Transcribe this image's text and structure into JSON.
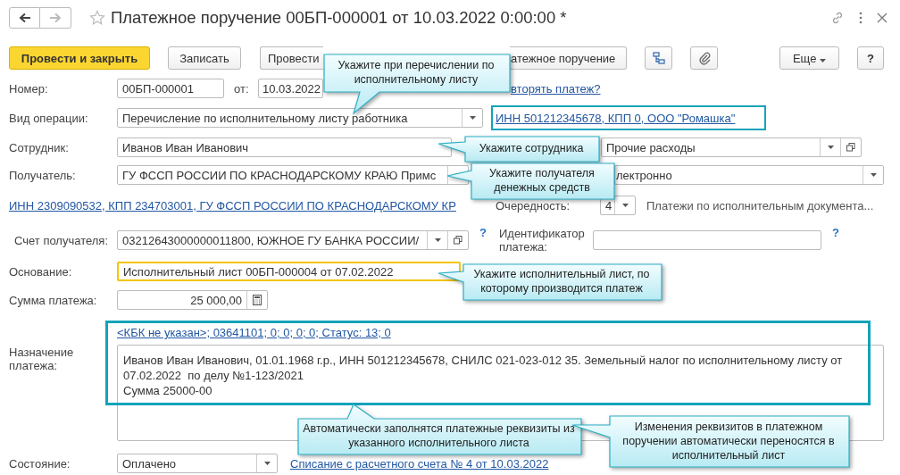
{
  "window": {
    "title": "Платежное поручение 00БП-000001 от 10.03.2022 0:00:00 *"
  },
  "toolbar": {
    "buttons": [
      {
        "kind": "primary",
        "label": "Провести и закрыть"
      },
      {
        "kind": "text",
        "label": "Записать"
      },
      {
        "kind": "text",
        "label": "Провести"
      },
      {
        "kind": "text",
        "label": "атежное поручение"
      }
    ],
    "more_button": "Еще",
    "help_button": "?"
  },
  "form": {
    "number": {
      "label": "Номер:",
      "value": "00БП-000001"
    },
    "date": {
      "label": "от:",
      "value": "10.03.2022"
    },
    "repeat_link": "вторять платеж?",
    "operation": {
      "label": "Вид операции:",
      "value": "Перечисление по исполнительному листу работника"
    },
    "payer_link": "ИНН 501212345678, КПП 0, ООО \"Ромашка\"",
    "employee": {
      "label": "Сотрудник:",
      "value": "Иванов Иван Иванович"
    },
    "expense": {
      "value": "Прочие расходы"
    },
    "recipient": {
      "label": "Получатель:",
      "value": "ГУ ФССП РОССИИ ПО КРАСНОДАРСКОМУ КРАЮ Примс"
    },
    "payment_method": {
      "value": "лектронно"
    },
    "recipient_link": "ИНН 2309090532, КПП 234703001, ГУ ФССП РОССИИ ПО КРАСНОДАРСКОМУ КР",
    "priority": {
      "label": "Очередность:",
      "value": "4",
      "description": "Платежи по исполнительным документа..."
    },
    "account": {
      "label": "Счет получателя:",
      "value": "03212643000000011800, ЮЖНОЕ ГУ БАНКА РОССИИ/",
      "help": "?"
    },
    "payment_id": {
      "label": "Идентификатор платежа:",
      "help": "?"
    },
    "basis": {
      "label": "Основание:",
      "value": "Исполнительный лист 00БП-000004 от 07.02.2022",
      "focused": true
    },
    "amount": {
      "label": "Сумма платежа:",
      "value": "25 000,00"
    },
    "purpose": {
      "label": "Назначение платежа:",
      "codes_link": "<КБК не указан>; 03641101; 0; 0; 0; 0; Статус: 13; 0",
      "text": "Иванов Иван Иванович, 01.01.1968 г.р., ИНН 501212345678, СНИЛС 021-023-012 35. Земельный налог по исполнительному листу от 07.02.2022  по делу №1-123/2021\nСумма 25000-00"
    },
    "status": {
      "label": "Состояние:",
      "value": "Оплачено",
      "link": "Списание с расчетного счета № 4 от 10.03.2022"
    }
  },
  "callouts": [
    "Укажите при перечислении по исполнительному листу",
    "Укажите сотрудника",
    "Укажите получателя денежных средств",
    "Укажите исполнительный лист, по которому производится платеж",
    "Автоматически заполнятся платежные реквизиты из указанного исполнительного листа",
    "Изменения реквизитов в платежном поручении автоматически переносятся в исполнительный лист"
  ]
}
